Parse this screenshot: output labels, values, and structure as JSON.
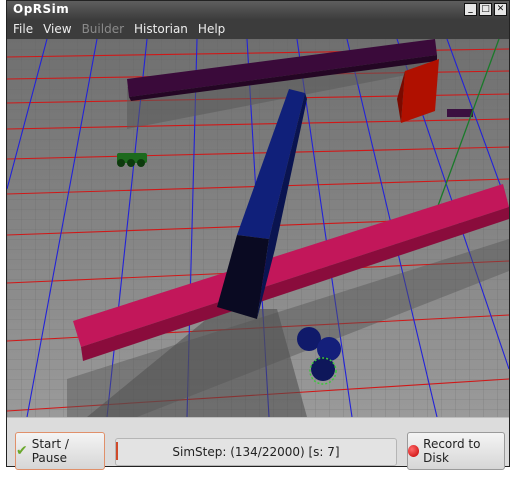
{
  "window": {
    "title": "OpRSim",
    "controls": [
      "minimize",
      "maximize",
      "close"
    ]
  },
  "menu": {
    "items": [
      {
        "label": "File",
        "enabled": true
      },
      {
        "label": "View",
        "enabled": true
      },
      {
        "label": "Builder",
        "enabled": false
      },
      {
        "label": "Historian",
        "enabled": true
      },
      {
        "label": "Help",
        "enabled": true
      }
    ]
  },
  "controls": {
    "start_pause_label": "Start / Pause",
    "start_icon": "checkmark-icon",
    "status_text": "SimStep: (134/22000) [s: 7]",
    "record_label": "Record to Disk",
    "record_icon": "red-dot-icon"
  },
  "colors": {
    "floor": "#8a8a8a",
    "grid_red": "#d01818",
    "grid_blue": "#2020d0",
    "wall_pink": "#b8104e",
    "wall_purple": "#3a0a3a",
    "pillar_blue": "#10207a",
    "block_red": "#b01000"
  }
}
